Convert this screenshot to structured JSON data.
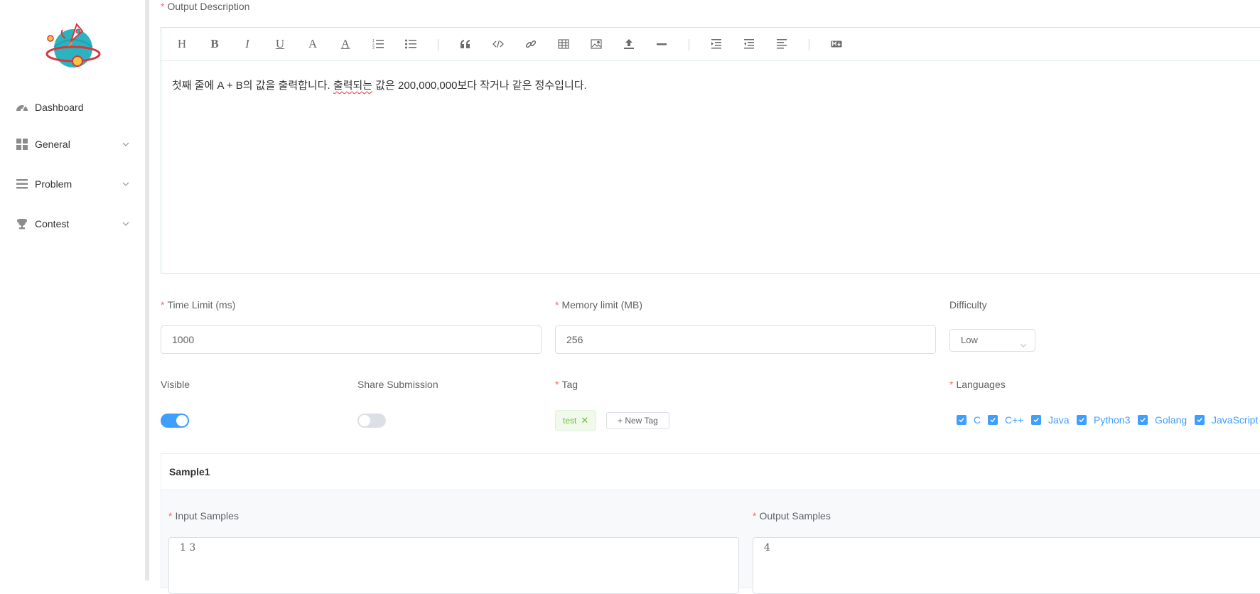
{
  "sidebar": {
    "logo_icon": "rocket-planet-logo",
    "items": [
      {
        "label": "Dashboard",
        "icon": "dashboard-icon"
      },
      {
        "label": "General",
        "icon": "grid-icon"
      },
      {
        "label": "Problem",
        "icon": "list-icon"
      },
      {
        "label": "Contest",
        "icon": "trophy-icon"
      }
    ]
  },
  "form": {
    "output_description": {
      "label": "Output Description",
      "content_part1": "첫째 줄에 A + B의 값을 출력합니다. ",
      "content_misspelled": "출력되는",
      "content_part2": " 값은 200,000,000보다 작거나 같은 정수입니다."
    },
    "time_limit": {
      "label": "Time Limit (ms)",
      "value": "1000"
    },
    "memory_limit": {
      "label": "Memory limit (MB)",
      "value": "256"
    },
    "difficulty": {
      "label": "Difficulty",
      "value": "Low"
    },
    "visible": {
      "label": "Visible",
      "on": true
    },
    "share_submission": {
      "label": "Share Submission",
      "on": false
    },
    "tag": {
      "label": "Tag",
      "tags": [
        "test"
      ],
      "new_tag_label": "+ New Tag"
    },
    "languages": {
      "label": "Languages",
      "items": [
        "C",
        "C++",
        "Java",
        "Python3",
        "Golang",
        "JavaScript"
      ]
    },
    "sample": {
      "title": "Sample1",
      "input_label": "Input Samples",
      "input_value": "1 3",
      "output_label": "Output Samples",
      "output_value": "4"
    }
  },
  "colors": {
    "accent": "#409eff",
    "required": "#f56c6c",
    "tag_green": "#67c23a",
    "switch_off": "#dcdfe6"
  }
}
